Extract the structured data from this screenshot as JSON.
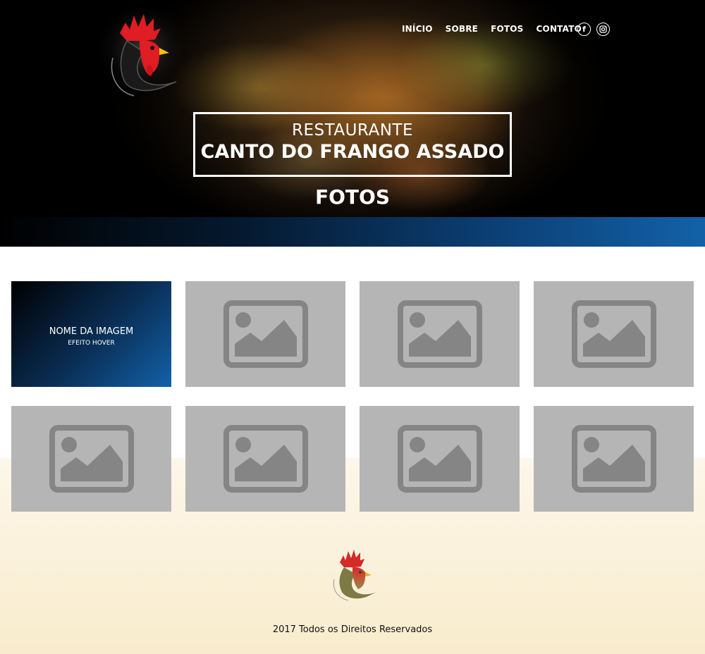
{
  "nav": {
    "items": [
      "INÍCIO",
      "SOBRE",
      "FOTOS",
      "CONTATO"
    ]
  },
  "social": {
    "facebook_label": "f",
    "instagram_icon": "instagram-icon"
  },
  "hero": {
    "title_small": "RESTAURANTE",
    "title_big": "CANTO DO FRANGO ASSADO",
    "subtitle": "FOTOS"
  },
  "gallery": {
    "hover_tile": {
      "name": "NOME DA IMAGEM",
      "effect": "EFEITO HOVER"
    },
    "placeholder_icon": "image-placeholder-icon",
    "tile_count": 8
  },
  "footer": {
    "copyright": "2017 Todos os Direitos Reservados"
  },
  "colors": {
    "placeholder_bg": "#b5b5b5",
    "placeholder_icon": "#858585",
    "accent_blue": "#1361a8",
    "rooster_red": "#e01c24",
    "rooster_beak": "#f5c400"
  }
}
